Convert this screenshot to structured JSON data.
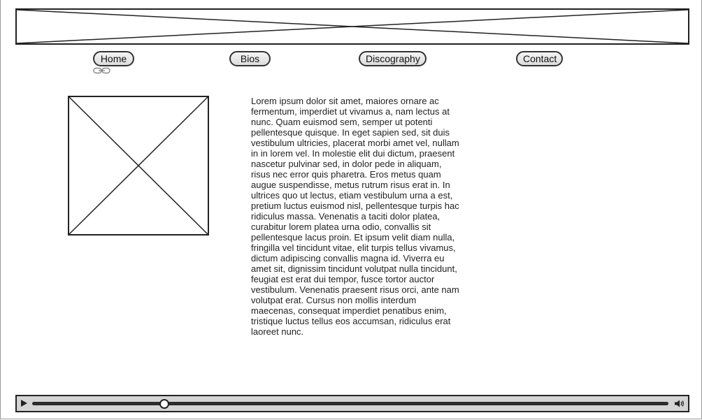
{
  "header": {
    "banner_image": "image-placeholder"
  },
  "nav": {
    "items": [
      {
        "label": "Home"
      },
      {
        "label": "Bios"
      },
      {
        "label": "Discography"
      },
      {
        "label": "Contact"
      }
    ],
    "link_icon": "link-icon"
  },
  "main": {
    "photo": "image-placeholder",
    "paragraph": "Lorem ipsum dolor sit amet, maiores ornare ac fermentum, imperdiet ut vivamus a, nam lectus at nunc. Quam euismod sem, semper ut potenti pellentesque quisque. In eget sapien sed, sit duis vestibulum ultricies, placerat morbi amet vel, nullam in in lorem vel. In molestie elit dui dictum, praesent nascetur pulvinar sed, in dolor pede in aliquam, risus nec error quis pharetra. Eros metus quam augue suspendisse, metus rutrum risus erat in.  In ultrices quo ut lectus, etiam vestibulum urna a est, pretium luctus euismod nisl, pellentesque turpis hac ridiculus massa. Venenatis a taciti dolor platea, curabitur lorem platea urna odio, convallis sit pellentesque lacus proin. Et ipsum velit diam nulla, fringilla vel tincidunt vitae, elit turpis tellus vivamus, dictum adipiscing convallis magna id. Viverra eu amet sit, dignissim tincidunt volutpat nulla tincidunt, feugiat est erat dui tempor, fusce tortor auctor vestibulum. Venenatis praesent risus orci, ante nam volutpat erat. Cursus non mollis interdum maecenas, consequat imperdiet penatibus enim, tristique luctus tellus eos accumsan, ridiculus erat laoreet nunc."
  },
  "player": {
    "play_icon": "play-icon",
    "volume_icon": "volume-icon",
    "progress_fraction": 0.208
  }
}
